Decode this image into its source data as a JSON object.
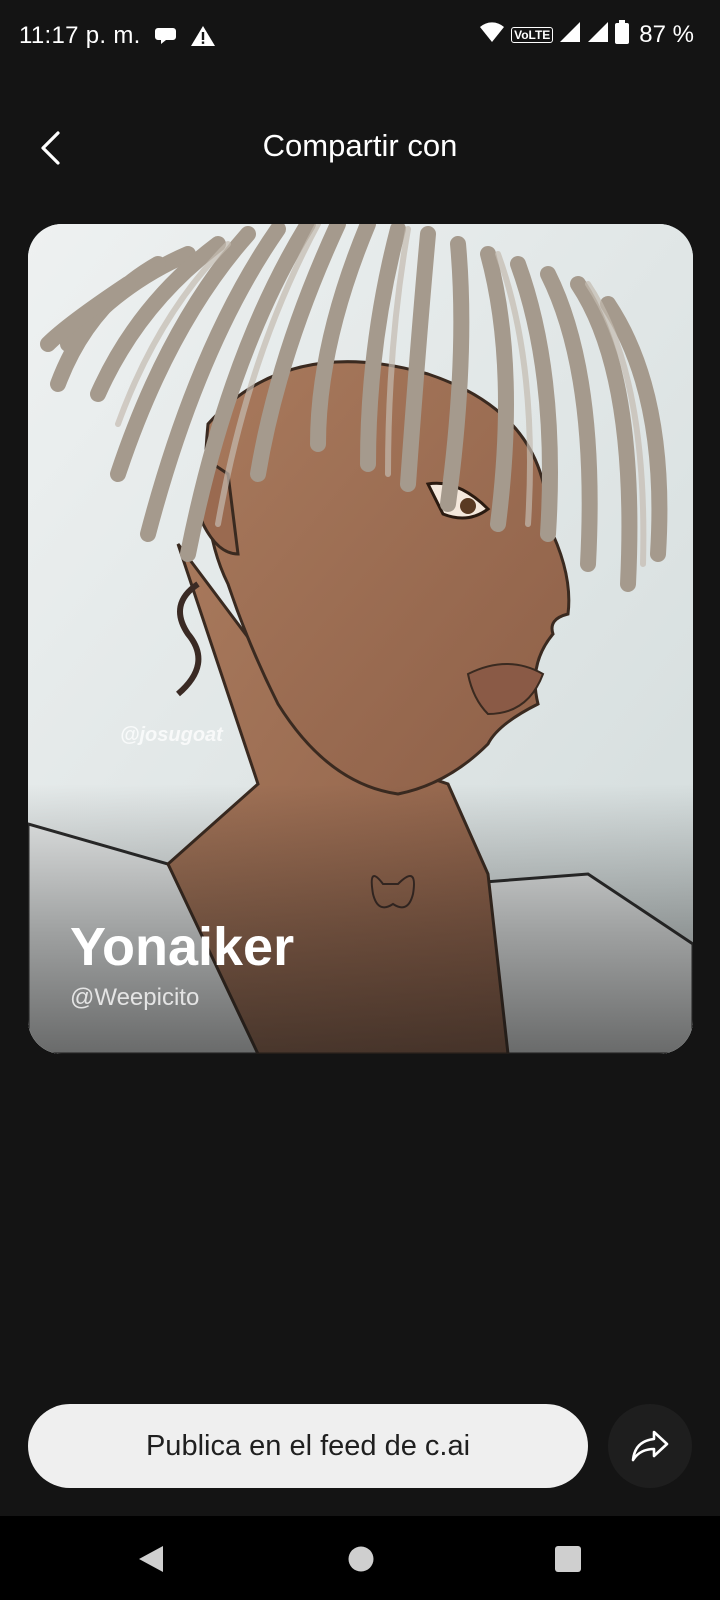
{
  "status_bar": {
    "time": "11:17 p. m.",
    "network_label": "VoLTE",
    "battery": "87 %"
  },
  "header": {
    "title": "Compartir con",
    "back_icon": "chevron-left-icon"
  },
  "card": {
    "name": "Yonaiker",
    "handle": "@Weepicito",
    "watermark": "@josugoat"
  },
  "actions": {
    "publish_label": "Publica en el feed de c.ai",
    "share_icon": "share-icon"
  },
  "colors": {
    "background": "#141414",
    "button_bg": "#efefef",
    "share_bg": "#1e1e1e"
  }
}
